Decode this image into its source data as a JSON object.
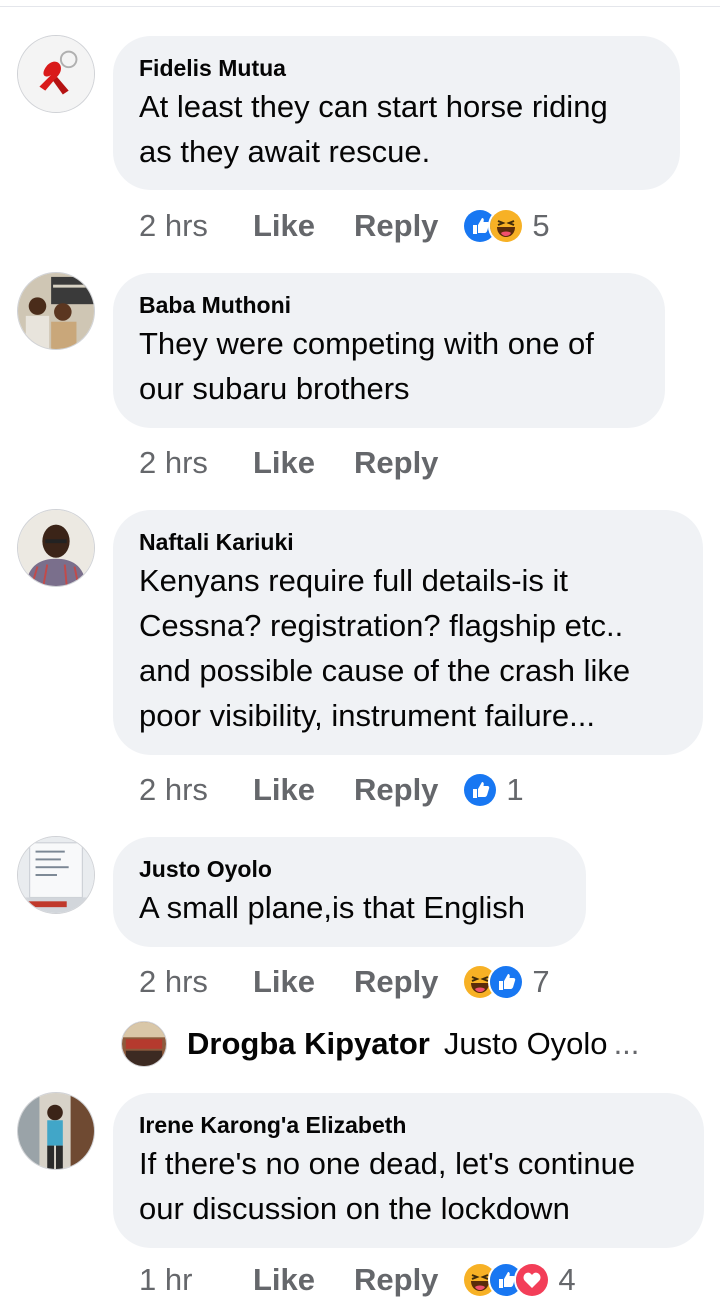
{
  "comments": [
    {
      "author": "Fidelis Mutua",
      "lines": [
        "At least they can start horse riding",
        "as they await rescue."
      ],
      "time": "2 hrs",
      "like": "Like",
      "reply": "Reply",
      "reactions": [
        "like-icon",
        "haha-icon"
      ],
      "count": "5"
    },
    {
      "author": "Baba Muthoni",
      "lines": [
        "They were competing with one of",
        "our subaru brothers"
      ],
      "time": "2 hrs",
      "like": "Like",
      "reply": "Reply",
      "reactions": [],
      "count": ""
    },
    {
      "author": "Naftali Kariuki",
      "lines": [
        "Kenyans require  full details-is it",
        "Cessna? registration? flagship etc..",
        "and possible cause of the crash like",
        "poor visibility, instrument failure..."
      ],
      "time": "2 hrs",
      "like": "Like",
      "reply": "Reply",
      "reactions": [
        "like-icon"
      ],
      "count": "1"
    },
    {
      "author": "Justo Oyolo",
      "lines": [
        "A small plane,is that English"
      ],
      "time": "2 hrs",
      "like": "Like",
      "reply": "Reply",
      "reactions": [
        "haha-icon",
        "like-icon"
      ],
      "count": "7"
    },
    {
      "author": "Irene Karong'a Elizabeth",
      "lines": [
        "If there's no one dead, let's continue",
        "our discussion on the lockdown"
      ],
      "time": "1 hr",
      "like": "Like",
      "reply": "Reply",
      "reactions": [
        "haha-icon",
        "like-icon",
        "love-icon"
      ],
      "count": "4"
    }
  ],
  "nested_reply": {
    "author": "Drogba Kipyator",
    "preview": "Justo Oyolo",
    "ellipsis": "..."
  },
  "colors": {
    "bubble": "#f0f2f5",
    "meta": "#65676b",
    "like_blue": "#1877f2",
    "haha_yellow": "#f7b125"
  }
}
